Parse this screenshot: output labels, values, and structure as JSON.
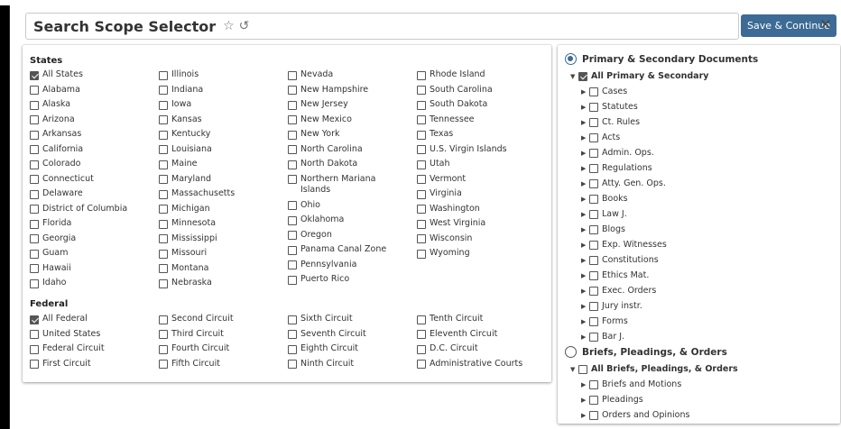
{
  "header": {
    "title": "Search Scope Selector",
    "save_label": "Save & Continue",
    "close": "×"
  },
  "states": {
    "heading": "States",
    "columns": [
      [
        {
          "label": "All States",
          "checked": true
        },
        {
          "label": "Alabama"
        },
        {
          "label": "Alaska"
        },
        {
          "label": "Arizona"
        },
        {
          "label": "Arkansas"
        },
        {
          "label": "California"
        },
        {
          "label": "Colorado"
        },
        {
          "label": "Connecticut"
        },
        {
          "label": "Delaware"
        },
        {
          "label": "District of Columbia"
        },
        {
          "label": "Florida"
        },
        {
          "label": "Georgia"
        },
        {
          "label": "Guam"
        },
        {
          "label": "Hawaii"
        },
        {
          "label": "Idaho"
        }
      ],
      [
        {
          "label": "Illinois"
        },
        {
          "label": "Indiana"
        },
        {
          "label": "Iowa"
        },
        {
          "label": "Kansas"
        },
        {
          "label": "Kentucky"
        },
        {
          "label": "Louisiana"
        },
        {
          "label": "Maine"
        },
        {
          "label": "Maryland"
        },
        {
          "label": "Massachusetts"
        },
        {
          "label": "Michigan"
        },
        {
          "label": "Minnesota"
        },
        {
          "label": "Mississippi"
        },
        {
          "label": "Missouri"
        },
        {
          "label": "Montana"
        },
        {
          "label": "Nebraska"
        }
      ],
      [
        {
          "label": "Nevada"
        },
        {
          "label": "New Hampshire"
        },
        {
          "label": "New Jersey"
        },
        {
          "label": "New Mexico"
        },
        {
          "label": "New York"
        },
        {
          "label": "North Carolina"
        },
        {
          "label": "North Dakota"
        },
        {
          "label": "Northern Mariana Islands"
        },
        {
          "label": "Ohio"
        },
        {
          "label": "Oklahoma"
        },
        {
          "label": "Oregon"
        },
        {
          "label": "Panama Canal Zone"
        },
        {
          "label": "Pennsylvania"
        },
        {
          "label": "Puerto Rico"
        }
      ],
      [
        {
          "label": "Rhode Island"
        },
        {
          "label": "South Carolina"
        },
        {
          "label": "South Dakota"
        },
        {
          "label": "Tennessee"
        },
        {
          "label": "Texas"
        },
        {
          "label": "U.S. Virgin Islands"
        },
        {
          "label": "Utah"
        },
        {
          "label": "Vermont"
        },
        {
          "label": "Virginia"
        },
        {
          "label": "Washington"
        },
        {
          "label": "West Virginia"
        },
        {
          "label": "Wisconsin"
        },
        {
          "label": "Wyoming"
        }
      ]
    ]
  },
  "federal": {
    "heading": "Federal",
    "columns": [
      [
        {
          "label": "All Federal",
          "checked": true
        },
        {
          "label": "United States"
        },
        {
          "label": "Federal Circuit"
        },
        {
          "label": "First Circuit"
        }
      ],
      [
        {
          "label": "Second Circuit"
        },
        {
          "label": "Third Circuit"
        },
        {
          "label": "Fourth Circuit"
        },
        {
          "label": "Fifth Circuit"
        }
      ],
      [
        {
          "label": "Sixth Circuit"
        },
        {
          "label": "Seventh Circuit"
        },
        {
          "label": "Eighth Circuit"
        },
        {
          "label": "Ninth Circuit"
        }
      ],
      [
        {
          "label": "Tenth Circuit"
        },
        {
          "label": "Eleventh Circuit"
        },
        {
          "label": "D.C. Circuit"
        },
        {
          "label": "Administrative Courts"
        }
      ]
    ]
  },
  "doc_types": {
    "primary": {
      "label": "Primary & Secondary Documents",
      "selected": true,
      "parent": "All Primary & Secondary",
      "parent_checked": true,
      "children": [
        "Cases",
        "Statutes",
        "Ct. Rules",
        "Acts",
        "Admin. Ops.",
        "Regulations",
        "Atty. Gen. Ops.",
        "Books",
        "Law J.",
        "Blogs",
        "Exp. Witnesses",
        "Constitutions",
        "Ethics Mat.",
        "Exec. Orders",
        "Jury instr.",
        "Forms",
        "Bar J."
      ]
    },
    "briefs": {
      "label": "Briefs, Pleadings, & Orders",
      "selected": false,
      "parent": "All Briefs, Pleadings, & Orders",
      "parent_checked": false,
      "children": [
        "Briefs and Motions",
        "Pleadings",
        "Orders and Opinions"
      ]
    }
  },
  "colors": {
    "accent": "#3d6b95",
    "checkbox": "#555555"
  }
}
